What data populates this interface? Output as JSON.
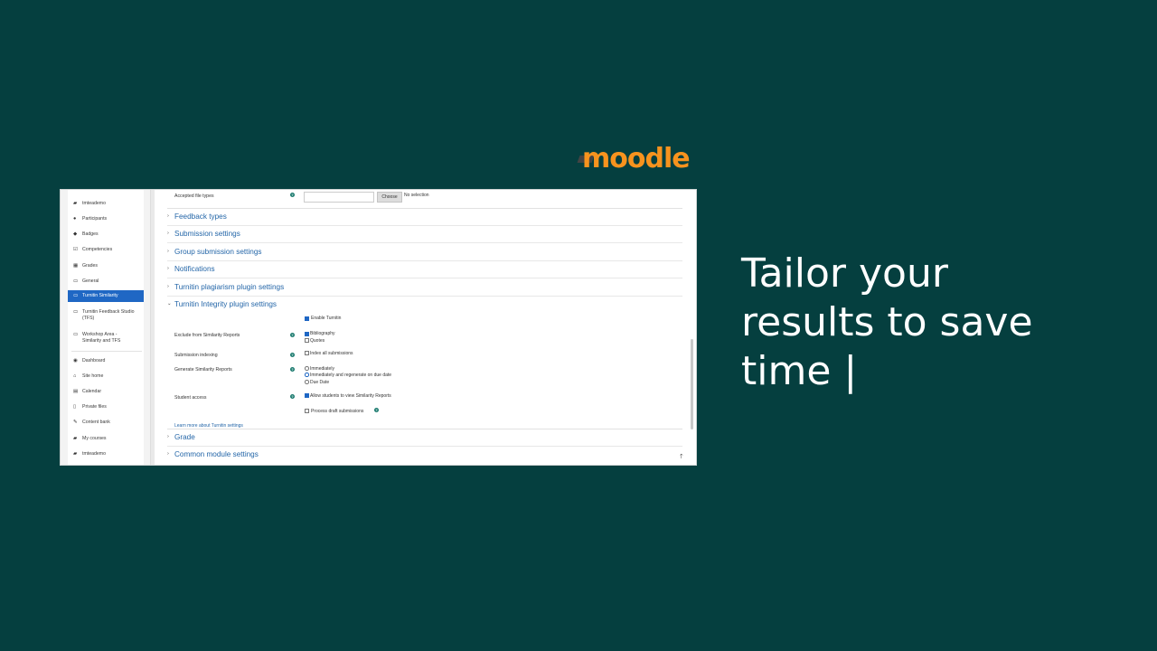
{
  "brand": {
    "logo_text": "moodle"
  },
  "tagline": {
    "lines": [
      "Tailor your",
      "results to save",
      "time |"
    ]
  },
  "sidebar": {
    "items": [
      {
        "label": "tmteademo",
        "icon": "graduation-cap-icon"
      },
      {
        "label": "Participants",
        "icon": "users-icon"
      },
      {
        "label": "Badges",
        "icon": "shield-icon"
      },
      {
        "label": "Competencies",
        "icon": "check-icon"
      },
      {
        "label": "Grades",
        "icon": "table-icon"
      },
      {
        "label": "General",
        "icon": "folder-icon"
      },
      {
        "label": "Turnitin Similarity",
        "icon": "folder-icon",
        "active": true
      },
      {
        "label": "Turnitin Feedback Studio (TFS)",
        "icon": "folder-icon"
      },
      {
        "label": "Workshop Area - Similarity and TFS",
        "icon": "folder-icon"
      },
      {
        "label": "Dashboard",
        "icon": "dashboard-icon"
      },
      {
        "label": "Site home",
        "icon": "home-icon"
      },
      {
        "label": "Calendar",
        "icon": "calendar-icon"
      },
      {
        "label": "Private files",
        "icon": "file-icon"
      },
      {
        "label": "Content bank",
        "icon": "pencil-icon"
      },
      {
        "label": "My courses",
        "icon": "graduation-cap-icon"
      },
      {
        "label": "tmteademo",
        "icon": "graduation-cap-icon"
      }
    ]
  },
  "form": {
    "accepted_file_types": {
      "label": "Accepted file types",
      "button": "Choose",
      "status": "No selection"
    },
    "sections": [
      "Feedback types",
      "Submission settings",
      "Group submission settings",
      "Notifications",
      "Turnitin plagiarism plugin settings",
      "Turnitin Integrity plugin settings"
    ],
    "enable_turnitin": "Enable Turnitin",
    "exclude": {
      "label": "Exclude from Similarity Reports",
      "options": [
        "Bibliography",
        "Quotes"
      ]
    },
    "indexing": {
      "label": "Submission indexing",
      "option": "Index all submissions"
    },
    "generate": {
      "label": "Generate Similarity Reports",
      "options": [
        "Immediately",
        "Immediately and regenerate on due date",
        "Due Date"
      ]
    },
    "student_access": {
      "label": "Student access",
      "option": "Allow students to view Similarity Reports"
    },
    "process_draft": "Process draft submissions",
    "learn_more": "Learn more about Turnitin settings",
    "bottom_sections": [
      "Grade",
      "Common module settings"
    ]
  }
}
